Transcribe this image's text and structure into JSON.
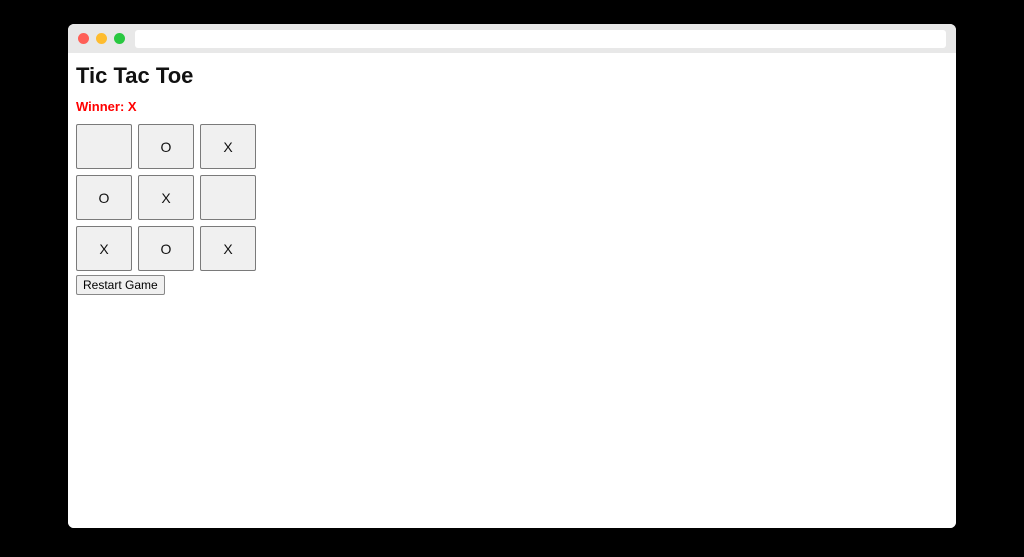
{
  "browser": {
    "url": ""
  },
  "page": {
    "title": "Tic Tac Toe",
    "status": "Winner: X",
    "status_color": "#ff0000",
    "restart_label": "Restart Game"
  },
  "board": {
    "cells": [
      "",
      "O",
      "X",
      "O",
      "X",
      "",
      "X",
      "O",
      "X"
    ]
  }
}
